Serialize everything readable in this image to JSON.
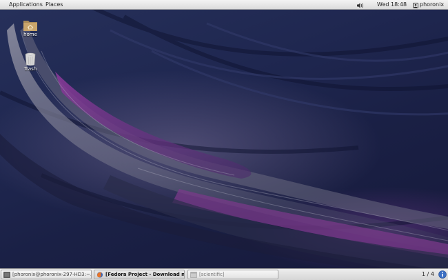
{
  "top_panel": {
    "applications_label": "Applications",
    "places_label": "Places",
    "clock": "Wed 18:48",
    "user_name": "phoronix",
    "volume_icon": "speaker-icon",
    "user_icon": "user-icon"
  },
  "desktop": {
    "icons": [
      {
        "label": "home",
        "icon": "folder-home-icon"
      },
      {
        "label": "Trash",
        "icon": "trash-icon"
      }
    ]
  },
  "taskbar": {
    "tasks": [
      {
        "label": "[phoronix@phoronix-297-HD3:~...",
        "icon": "terminal-icon",
        "state": "minimized"
      },
      {
        "label": "[Fedora Project - Download nex...",
        "icon": "firefox-icon",
        "state": "active"
      },
      {
        "label": "[scientific]",
        "icon": "window-icon",
        "state": "minimized"
      }
    ],
    "workspace": "1 / 4",
    "notification_icon": "info-icon"
  },
  "colors": {
    "wallpaper_dark": "#1a2045",
    "wallpaper_purple": "#7a3a8a",
    "panel": "#e4e4e4",
    "notify_blue": "#3b6fc4"
  }
}
